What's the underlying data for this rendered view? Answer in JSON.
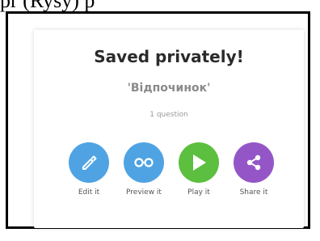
{
  "header_fragment": "pr (Rysy)               p",
  "dialog": {
    "title": "Saved privately!",
    "quiz_name": "'Відпочинок'",
    "question_count": "1 question"
  },
  "actions": [
    {
      "label": "Edit it",
      "icon": "pencil-icon",
      "color": "#4fa3e3"
    },
    {
      "label": "Preview it",
      "icon": "glasses-icon",
      "color": "#4fa3e3"
    },
    {
      "label": "Play it",
      "icon": "play-icon",
      "color": "#5cbf3f"
    },
    {
      "label": "Share it",
      "icon": "share-icon",
      "color": "#9456c7"
    }
  ]
}
